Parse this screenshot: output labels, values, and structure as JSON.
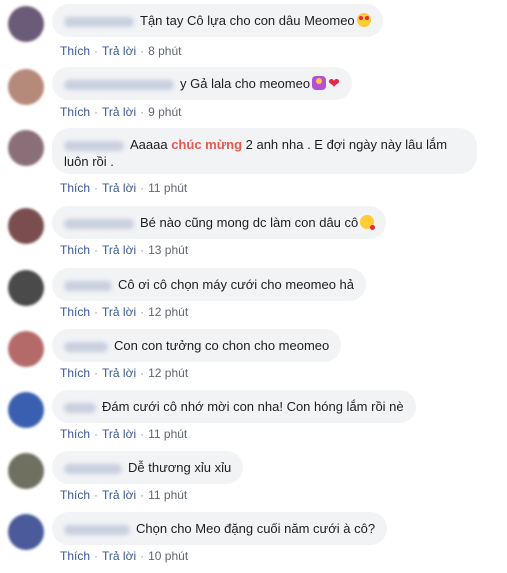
{
  "ui": {
    "like_label": "Thích",
    "reply_label": "Trả lời",
    "separator": "·"
  },
  "comments": [
    {
      "avatar_color": "#6b5a78",
      "name_width": 70,
      "text": "Tận tay Cô lựa cho con dâu Meomeo",
      "emoji": "heart-eyes",
      "time": "8 phút"
    },
    {
      "avatar_color": "#b58a7a",
      "name_width": 110,
      "text": "y Gả lala cho meomeo",
      "emoji": "person-heart",
      "time": "9 phút"
    },
    {
      "avatar_color": "#8a6f78",
      "name_width": 60,
      "text_before": "Aaaaa ",
      "highlight": "chúc mừng",
      "text_after": " 2 anh nha . E đợi ngày này lâu lắm luôn rồi .",
      "time": "11 phút"
    },
    {
      "avatar_color": "#7a4e4e",
      "name_width": 70,
      "text": "Bé nào cũng mong dc làm con dâu cô",
      "emoji": "wink-kiss",
      "time": "13 phút"
    },
    {
      "avatar_color": "#4a4a4a",
      "name_width": 48,
      "text": "Cô ơi cô chọn máy cưới cho meomeo hả",
      "time": "12 phút"
    },
    {
      "avatar_color": "#b56a6a",
      "name_width": 44,
      "text": "Con con tưởng co chon cho meomeo",
      "time": "12 phút"
    },
    {
      "avatar_color": "#3a5fb0",
      "name_width": 32,
      "text": "Đám cưới cô nhớ mời con nha! Con hóng lắm rồi nè",
      "time": "11 phút"
    },
    {
      "avatar_color": "#6f7060",
      "name_width": 58,
      "text": "Dễ thương xỉu xỉu",
      "time": "11 phút"
    },
    {
      "avatar_color": "#4a5a9a",
      "name_width": 66,
      "text": "Chọn cho Meo đặng cuối năm cưới à cô?",
      "time": "10 phút"
    }
  ]
}
